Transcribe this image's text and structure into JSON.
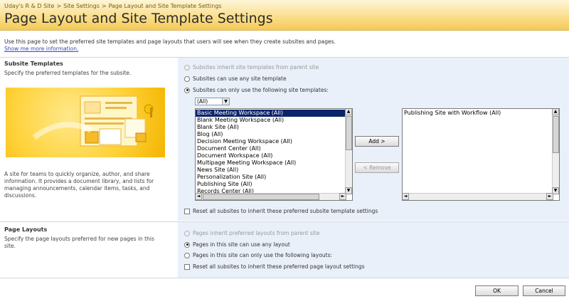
{
  "breadcrumb": {
    "site": "Uday's R & D Site",
    "settings": "Site Settings",
    "current": "Page Layout and Site Template Settings",
    "separator": ">"
  },
  "page_title": "Page Layout and Site Template Settings",
  "intro": {
    "text": "Use this page to set the preferred site templates and page layouts that users will see when they create subsites and pages.",
    "more_link": "Show me more information."
  },
  "subsite_templates": {
    "title": "Subsite Templates",
    "description": "Specify the preferred templates for the subsite.",
    "template_description": "A site for teams to quickly organize, author, and share information. It provides a document library, and lists for managing announcements, calendar items, tasks, and discussions.",
    "options": {
      "inherit": "Subsites inherit site templates from parent site",
      "any": "Subsites can use any site template",
      "only": "Subsites can only use the following site templates:"
    },
    "language_filter": "(All)",
    "available_templates": [
      "Basic Meeting Workspace (All)",
      "Blank Meeting Workspace (All)",
      "Blank Site (All)",
      "Blog (All)",
      "Decision Meeting Workspace (All)",
      "Document Center (All)",
      "Document Workspace (All)",
      "Multipage Meeting Workspace (All)",
      "News Site (All)",
      "Personalization Site (All)",
      "Publishing Site (All)",
      "Records Center (All)"
    ],
    "selected_templates": [
      "Publishing Site with Workflow (All)"
    ],
    "add_button": "Add >",
    "remove_button": "< Remove",
    "reset_label": "Reset all subsites to inherit these preferred subsite template settings"
  },
  "page_layouts": {
    "title": "Page Layouts",
    "description": "Specify the page layouts preferred for new pages in this site.",
    "options": {
      "inherit": "Pages inherit preferred layouts from parent site",
      "any": "Pages in this site can use any layout",
      "only": "Pages in this site can only use the following layouts:"
    },
    "reset_label": "Reset all subsites to inherit these preferred page layout settings"
  },
  "footer": {
    "ok": "OK",
    "cancel": "Cancel"
  }
}
